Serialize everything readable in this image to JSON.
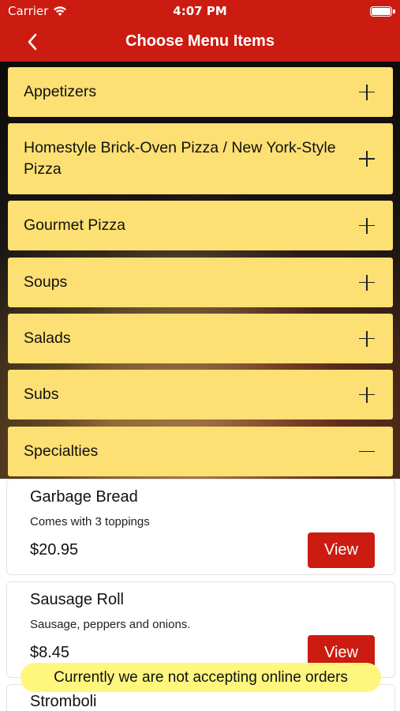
{
  "status_bar": {
    "carrier": "Carrier",
    "time": "4:07 PM",
    "icons": [
      "wifi-icon",
      "battery-icon"
    ]
  },
  "nav": {
    "title": "Choose Menu Items",
    "back_icon": "chevron-left-icon"
  },
  "categories": [
    {
      "label": "Appetizers",
      "state": "collapsed"
    },
    {
      "label": "Homestyle Brick-Oven Pizza / New York-Style Pizza",
      "state": "collapsed"
    },
    {
      "label": "Gourmet Pizza",
      "state": "collapsed"
    },
    {
      "label": "Soups",
      "state": "collapsed"
    },
    {
      "label": "Salads",
      "state": "collapsed"
    },
    {
      "label": "Subs",
      "state": "collapsed"
    },
    {
      "label": "Specialties",
      "state": "expanded"
    }
  ],
  "items": [
    {
      "name": "Garbage Bread",
      "description": "Comes with 3 toppings",
      "price": "$20.95",
      "button": "View"
    },
    {
      "name": "Sausage Roll",
      "description": "Sausage, peppers and onions.",
      "price": "$8.45",
      "button": "View"
    },
    {
      "name": "Stromboli"
    }
  ],
  "toast": "Currently we are not accepting online orders",
  "colors": {
    "brand_red": "#cc1b10",
    "category_yellow": "#fde073",
    "toast_yellow": "#fff67e"
  }
}
